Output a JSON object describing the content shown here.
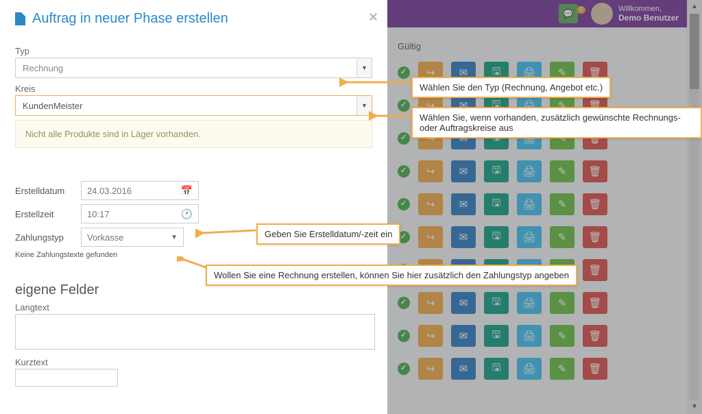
{
  "header": {
    "chat_badge": "0",
    "welcome_small": "Willkommen,",
    "welcome_user": "Demo Benutzer"
  },
  "column_header": "Gültig",
  "modal": {
    "title": "Auftrag in neuer Phase erstellen",
    "typ_label": "Typ",
    "typ_value": "Rechnung",
    "kreis_label": "Kreis",
    "kreis_value": "KundenMeister",
    "warning": "Nicht alle Produkte sind in Läger vorhanden.",
    "erstelldatum_label": "Erstelldatum",
    "erstelldatum_value": "24.03.2016",
    "erstellzeit_label": "Erstellzeit",
    "erstellzeit_value": "10:17",
    "zahlungstyp_label": "Zahlungstyp",
    "zahlungstyp_value": "Vorkasse",
    "zahlungstext_note": "Keine Zahlungstexte gefunden",
    "eigene_felder": "eigene Felder",
    "langtext_label": "Langtext",
    "kurztext_label": "Kurztext"
  },
  "callouts": {
    "c1": "Wählen Sie den Typ (Rechnung, Angebot etc.)",
    "c2": "Wählen Sie, wenn vorhanden, zusätzlich gewünschte Rechnungs- oder Auftragskreise aus",
    "c3": "Geben Sie Erstelldatum/-zeit ein",
    "c4": "Wollen Sie eine Rechnung erstellen, können Sie hier zusätzlich den Zahlungstyp angeben"
  },
  "colors": {
    "accent_orange": "#f0ad4e",
    "accent_blue": "#2b88c8",
    "header_purple": "#7a3e9d",
    "status_green": "#4caf50"
  }
}
